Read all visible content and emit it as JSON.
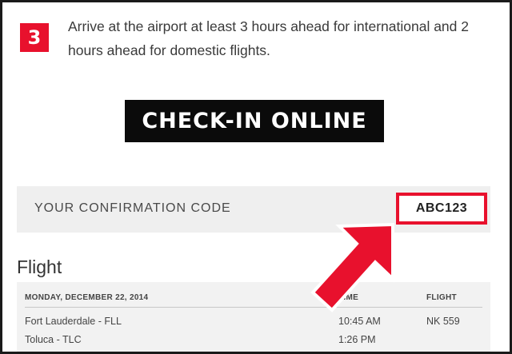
{
  "step": {
    "number": "3",
    "text": "Arrive at the airport at least 3 hours ahead for international and 2 hours ahead for domestic flights."
  },
  "checkin": {
    "label": "CHECK-IN ONLINE"
  },
  "confirmation": {
    "label": "YOUR CONFIRMATION CODE",
    "code": "ABC123"
  },
  "flight": {
    "title": "Flight",
    "date": "MONDAY, DECEMBER 22, 2014",
    "time_header": "TIME",
    "flight_header": "FLIGHT",
    "rows": [
      {
        "place": "Fort Lauderdale  -  FLL",
        "time": "10:45 AM",
        "flight": "NK 559"
      },
      {
        "place": "Toluca  -  TLC",
        "time": "1:26 PM",
        "flight": ""
      }
    ]
  },
  "colors": {
    "accent": "#e8112d",
    "button_bg": "#0b0b0b",
    "panel_bg": "#efefef"
  },
  "annotation": {
    "icon": "arrow-pointer-icon"
  }
}
